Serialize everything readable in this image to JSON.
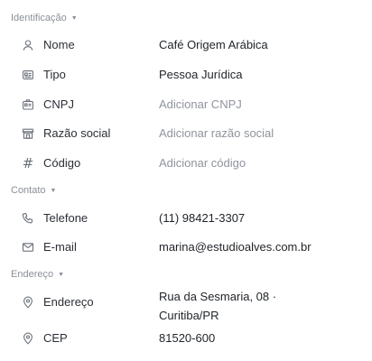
{
  "sections": {
    "identificacao": {
      "title": "Identificação",
      "rows": {
        "nome": {
          "label": "Nome",
          "value": "Café Origem Arábica",
          "icon": "user-icon"
        },
        "tipo": {
          "label": "Tipo",
          "value": "Pessoa Jurídica",
          "icon": "id-card-icon"
        },
        "cnpj": {
          "label": "CNPJ",
          "placeholder": "Adicionar CNPJ",
          "icon": "badge-icon"
        },
        "razao": {
          "label": "Razão social",
          "placeholder": "Adicionar razão social",
          "icon": "storefront-icon"
        },
        "codigo": {
          "label": "Código",
          "placeholder": "Adicionar código",
          "icon": "hash-icon",
          "glyph": "#"
        }
      }
    },
    "contato": {
      "title": "Contato",
      "rows": {
        "telefone": {
          "label": "Telefone",
          "value": "(11) 98421-3307",
          "icon": "phone-icon"
        },
        "email": {
          "label": "E-mail",
          "value": "marina@estudioalves.com.br",
          "icon": "mail-icon"
        }
      }
    },
    "endereco": {
      "title": "Endereço",
      "rows": {
        "endereco": {
          "label": "Endereço",
          "value": "Rua da Sesmaria, 08 · Curitiba/PR",
          "icon": "map-pin-icon"
        },
        "cep": {
          "label": "CEP",
          "value": "81520-600",
          "icon": "map-pin-icon"
        }
      }
    }
  },
  "caret": "▼",
  "colors": {
    "muted": "#8a8f98",
    "text": "#1f2328",
    "placeholder": "#8f949c",
    "icon": "#6b7079"
  }
}
